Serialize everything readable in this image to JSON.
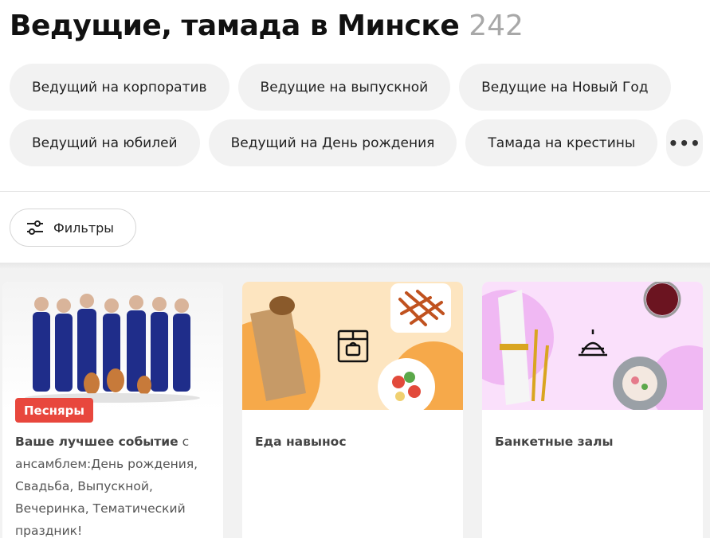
{
  "header": {
    "title": "Ведущие, тамада в Минске",
    "count": "242"
  },
  "chips": {
    "row1": [
      "Ведущий на корпоратив",
      "Ведущие на выпускной",
      "Ведущие на Новый Год"
    ],
    "row2": [
      "Ведущий на юбилей",
      "Ведущий на День рождения",
      "Тамада на крестины"
    ],
    "more": "•••"
  },
  "filters": {
    "label": "Фильтры"
  },
  "cards": [
    {
      "badge": "Песняры",
      "title": "Ваше лучшее событие",
      "text": " с ансамблем:День рождения, Свадьба, Выпускной, Вечеринка, Тематический праздник!"
    },
    {
      "title": "Еда навынос"
    },
    {
      "title": "Банкетные залы"
    }
  ],
  "colors": {
    "badge": "#e8473d",
    "chip_bg": "#f2f2f2",
    "count": "#a8a8a8"
  }
}
